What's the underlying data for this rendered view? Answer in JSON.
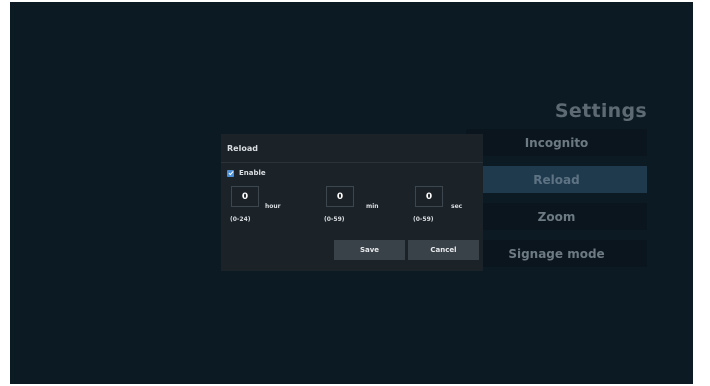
{
  "settings": {
    "title": "Settings",
    "menu": [
      {
        "label": "Incognito",
        "selected": false
      },
      {
        "label": "Reload",
        "selected": true
      },
      {
        "label": "Zoom",
        "selected": false
      },
      {
        "label": "Signage mode",
        "selected": false
      }
    ]
  },
  "dialog": {
    "title": "Reload",
    "enable": {
      "label": "Enable",
      "checked": true
    },
    "fields": [
      {
        "value": "0",
        "unit": "hour",
        "range": "(0-24)"
      },
      {
        "value": "0",
        "unit": "min",
        "range": "(0-59)"
      },
      {
        "value": "0",
        "unit": "sec",
        "range": "(0-59)"
      }
    ],
    "save_label": "Save",
    "cancel_label": "Cancel"
  },
  "colors": {
    "background": "#0c1a24",
    "dialog": "#1c2328",
    "selected_item": "#1f3a4d",
    "checkbox": "#4a8fd6"
  }
}
